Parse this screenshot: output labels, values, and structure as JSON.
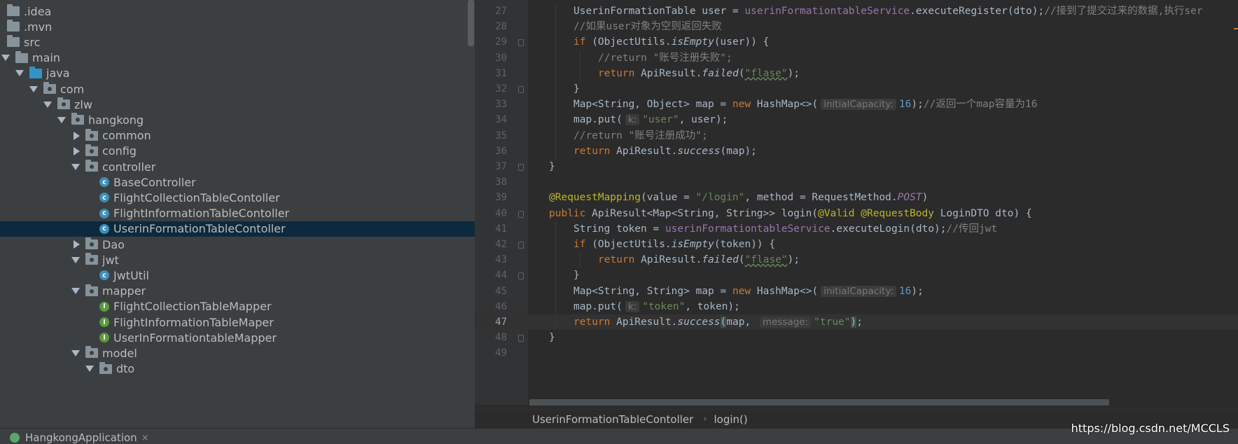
{
  "project_tree": [
    {
      "label": ".idea",
      "depth": 0,
      "arrow": "none",
      "icon": "folder"
    },
    {
      "label": ".mvn",
      "depth": 0,
      "arrow": "none",
      "icon": "folder"
    },
    {
      "label": "src",
      "depth": 0,
      "arrow": "none",
      "icon": "folder"
    },
    {
      "label": "main",
      "depth": 0,
      "arrow": "down",
      "icon": "folder"
    },
    {
      "label": "java",
      "depth": 1,
      "arrow": "down",
      "icon": "folder-blue"
    },
    {
      "label": "com",
      "depth": 2,
      "arrow": "down",
      "icon": "package"
    },
    {
      "label": "zlw",
      "depth": 3,
      "arrow": "down",
      "icon": "package"
    },
    {
      "label": "hangkong",
      "depth": 4,
      "arrow": "down",
      "icon": "package"
    },
    {
      "label": "common",
      "depth": 5,
      "arrow": "right",
      "icon": "package"
    },
    {
      "label": "config",
      "depth": 5,
      "arrow": "right",
      "icon": "package"
    },
    {
      "label": "controller",
      "depth": 5,
      "arrow": "down",
      "icon": "package"
    },
    {
      "label": "BaseController",
      "depth": 6,
      "arrow": "none",
      "icon": "class"
    },
    {
      "label": "FlightCollectionTableContoller",
      "depth": 6,
      "arrow": "none",
      "icon": "class"
    },
    {
      "label": "FlightInformationTableContoller",
      "depth": 6,
      "arrow": "none",
      "icon": "class"
    },
    {
      "label": "UserinFormationTableContoller",
      "depth": 6,
      "arrow": "none",
      "icon": "class",
      "selected": true
    },
    {
      "label": "Dao",
      "depth": 5,
      "arrow": "right",
      "icon": "package"
    },
    {
      "label": "jwt",
      "depth": 5,
      "arrow": "down",
      "icon": "package"
    },
    {
      "label": "JwtUtil",
      "depth": 6,
      "arrow": "none",
      "icon": "class"
    },
    {
      "label": "mapper",
      "depth": 5,
      "arrow": "down",
      "icon": "package"
    },
    {
      "label": "FlightCollectionTableMapper",
      "depth": 6,
      "arrow": "none",
      "icon": "interface"
    },
    {
      "label": "FlightInformationTableMaper",
      "depth": 6,
      "arrow": "none",
      "icon": "interface"
    },
    {
      "label": "UserInFormationtableMapper",
      "depth": 6,
      "arrow": "none",
      "icon": "interface"
    },
    {
      "label": "model",
      "depth": 5,
      "arrow": "down",
      "icon": "package"
    },
    {
      "label": "dto",
      "depth": 6,
      "arrow": "down",
      "icon": "package"
    }
  ],
  "editor": {
    "current_line": 47,
    "lines": [
      {
        "n": 27,
        "indent": 2,
        "tokens": [
          [
            "",
            "UserinFormationTable user = "
          ],
          [
            "fld",
            "userinFormationtableService"
          ],
          [
            "",
            ".executeRegister(dto);"
          ],
          [
            "cmt",
            "//接到了提交过来的数据,执行ser"
          ]
        ]
      },
      {
        "n": 28,
        "indent": 2,
        "tokens": [
          [
            "cmt",
            "//如果user对象为空则返回失败"
          ]
        ]
      },
      {
        "n": 29,
        "indent": 2,
        "fold": true,
        "tokens": [
          [
            "kw",
            "if "
          ],
          [
            "",
            "(ObjectUtils."
          ],
          [
            "it",
            "isEmpty"
          ],
          [
            "",
            "(user)) {"
          ]
        ]
      },
      {
        "n": 30,
        "indent": 3,
        "tokens": [
          [
            "cmt",
            "//return \"账号注册失败\";"
          ]
        ]
      },
      {
        "n": 31,
        "indent": 3,
        "tokens": [
          [
            "kw",
            "return "
          ],
          [
            "",
            "ApiResult."
          ],
          [
            "it",
            "failed"
          ],
          [
            "",
            "("
          ],
          [
            "strsq",
            "\"flase\""
          ],
          [
            "",
            ");"
          ]
        ]
      },
      {
        "n": 32,
        "indent": 2,
        "fold": true,
        "tokens": [
          [
            "",
            "}"
          ]
        ]
      },
      {
        "n": 33,
        "indent": 2,
        "tokens": [
          [
            "",
            "Map<String, Object> map = "
          ],
          [
            "kw",
            "new "
          ],
          [
            "",
            "HashMap<>("
          ],
          [
            "hint",
            "initialCapacity:"
          ],
          [
            "num",
            "16"
          ],
          [
            "",
            ");"
          ],
          [
            "cmt",
            "//返回一个map容量为16"
          ]
        ]
      },
      {
        "n": 34,
        "indent": 2,
        "tokens": [
          [
            "",
            "map.put("
          ],
          [
            "hint",
            "k:"
          ],
          [
            "str",
            "\"user\""
          ],
          [
            "",
            ", user);"
          ]
        ]
      },
      {
        "n": 35,
        "indent": 2,
        "tokens": [
          [
            "cmt",
            "//return \"账号注册成功\";"
          ]
        ]
      },
      {
        "n": 36,
        "indent": 2,
        "tokens": [
          [
            "kw",
            "return "
          ],
          [
            "",
            "ApiResult."
          ],
          [
            "it",
            "success"
          ],
          [
            "",
            "(map);"
          ]
        ]
      },
      {
        "n": 37,
        "indent": 1,
        "fold": true,
        "tokens": [
          [
            "",
            "}"
          ]
        ]
      },
      {
        "n": 38,
        "indent": 0,
        "tokens": []
      },
      {
        "n": 39,
        "indent": 1,
        "tokens": [
          [
            "ann",
            "@RequestMapping"
          ],
          [
            "",
            "("
          ],
          [
            "",
            "value = "
          ],
          [
            "str",
            "\"/login\""
          ],
          [
            "",
            ", "
          ],
          [
            "",
            "method = RequestMethod."
          ],
          [
            "fldit",
            "POST"
          ],
          [
            "",
            ")"
          ]
        ]
      },
      {
        "n": 40,
        "indent": 1,
        "fold": true,
        "tokens": [
          [
            "kw",
            "public "
          ],
          [
            "",
            "ApiResult<Map<String, String>> "
          ],
          [
            "fn",
            "login"
          ],
          [
            "",
            "("
          ],
          [
            "ann",
            "@Valid "
          ],
          [
            "ann",
            "@RequestBody "
          ],
          [
            "",
            "LoginDTO dto) {"
          ]
        ]
      },
      {
        "n": 41,
        "indent": 2,
        "tokens": [
          [
            "",
            "String token = "
          ],
          [
            "fld",
            "userinFormationtableService"
          ],
          [
            "",
            ".executeLogin(dto);"
          ],
          [
            "cmt",
            "//传回jwt"
          ]
        ]
      },
      {
        "n": 42,
        "indent": 2,
        "fold": true,
        "tokens": [
          [
            "kw",
            "if "
          ],
          [
            "",
            "(ObjectUtils."
          ],
          [
            "it",
            "isEmpty"
          ],
          [
            "",
            "(token)) {"
          ]
        ]
      },
      {
        "n": 43,
        "indent": 3,
        "tokens": [
          [
            "kw",
            "return "
          ],
          [
            "",
            "ApiResult."
          ],
          [
            "it",
            "failed"
          ],
          [
            "",
            "("
          ],
          [
            "strsq",
            "\"flase\""
          ],
          [
            "",
            ");"
          ]
        ]
      },
      {
        "n": 44,
        "indent": 2,
        "fold": true,
        "tokens": [
          [
            "",
            "}"
          ]
        ]
      },
      {
        "n": 45,
        "indent": 2,
        "tokens": [
          [
            "",
            "Map<String, String> map = "
          ],
          [
            "kw",
            "new "
          ],
          [
            "",
            "HashMap<>("
          ],
          [
            "hint",
            "initialCapacity:"
          ],
          [
            "num",
            "16"
          ],
          [
            "",
            ");"
          ]
        ]
      },
      {
        "n": 46,
        "indent": 2,
        "tokens": [
          [
            "",
            "map.put("
          ],
          [
            "hint",
            "k:"
          ],
          [
            "str",
            "\"token\""
          ],
          [
            "",
            ", token);"
          ]
        ]
      },
      {
        "n": 47,
        "indent": 2,
        "tokens": [
          [
            "kw",
            "return "
          ],
          [
            "",
            "ApiResult."
          ],
          [
            "it",
            "success"
          ],
          [
            "bhl",
            "("
          ],
          [
            "",
            "map, "
          ],
          [
            "hint",
            "message:"
          ],
          [
            "str",
            "\"true\""
          ],
          [
            "bhl",
            ")"
          ],
          [
            "",
            ";"
          ]
        ]
      },
      {
        "n": 48,
        "indent": 1,
        "fold": true,
        "tokens": [
          [
            "",
            "}"
          ]
        ]
      },
      {
        "n": 49,
        "indent": 0,
        "tokens": []
      }
    ]
  },
  "breadcrumb": {
    "class_name": "UserinFormationTableContoller",
    "separator": "›",
    "method_name": "login()"
  },
  "run_tab": {
    "label": "HangkongApplication",
    "close": "×"
  },
  "watermark": "https://blog.csdn.net/MCCLS",
  "colors": {
    "keyword": "#cc7832",
    "string": "#6a8759",
    "comment": "#808080",
    "field": "#9876aa",
    "annotation": "#bbb529",
    "number": "#6897bb",
    "selection": "#0d293e"
  }
}
